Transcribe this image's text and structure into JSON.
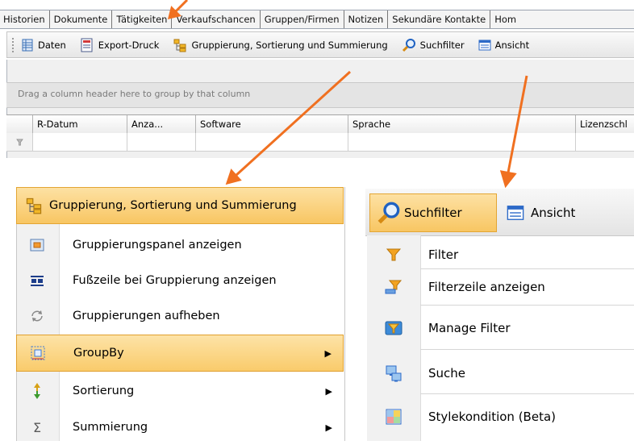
{
  "tabs": [
    "Historien",
    "Dokumente",
    "Tätigkeiten",
    "Verkaufschancen",
    "Gruppen/Firmen",
    "Notizen",
    "Sekundäre Kontakte",
    "Hom"
  ],
  "toolbar": {
    "daten": "Daten",
    "export": "Export-Druck",
    "gruppierung": "Gruppierung, Sortierung und Summierung",
    "suchfilter": "Suchfilter",
    "ansicht": "Ansicht"
  },
  "grid": {
    "group_hint": "Drag a column header here to group by that column",
    "columns": [
      "R-Datum",
      "Anza...",
      "Software",
      "Sprache",
      "Lizenzschl"
    ]
  },
  "menu_left": {
    "header": "Gruppierung, Sortierung und Summierung",
    "items": [
      {
        "label": "Gruppierungspanel anzeigen",
        "icon": "group-panel-icon"
      },
      {
        "label": "Fußzeile bei Gruppierung anzeigen",
        "icon": "footer-icon"
      },
      {
        "label": "Gruppierungen aufheben",
        "icon": "ungroup-icon"
      },
      {
        "label": "GroupBy",
        "icon": "groupby-icon",
        "submenu": true,
        "highlighted": true
      },
      {
        "label": "Sortierung",
        "icon": "sort-icon",
        "submenu": true
      },
      {
        "label": "Summierung",
        "icon": "sum-icon",
        "submenu": true
      }
    ]
  },
  "menu_right": {
    "suchfilter": "Suchfilter",
    "ansicht": "Ansicht",
    "items": [
      {
        "label": "Filter",
        "icon": "filter-icon"
      },
      {
        "label": "Filterzeile anzeigen",
        "icon": "filter-row-icon"
      },
      {
        "label": "Manage Filter",
        "icon": "manage-filter-icon"
      },
      {
        "label": "Suche",
        "icon": "search-computer-icon"
      },
      {
        "label": "Stylekondition (Beta)",
        "icon": "style-condition-icon"
      }
    ]
  },
  "colors": {
    "highlight": "#f9cb6b",
    "highlight_border": "#e0a02f",
    "annotation_arrow": "#f07020"
  }
}
